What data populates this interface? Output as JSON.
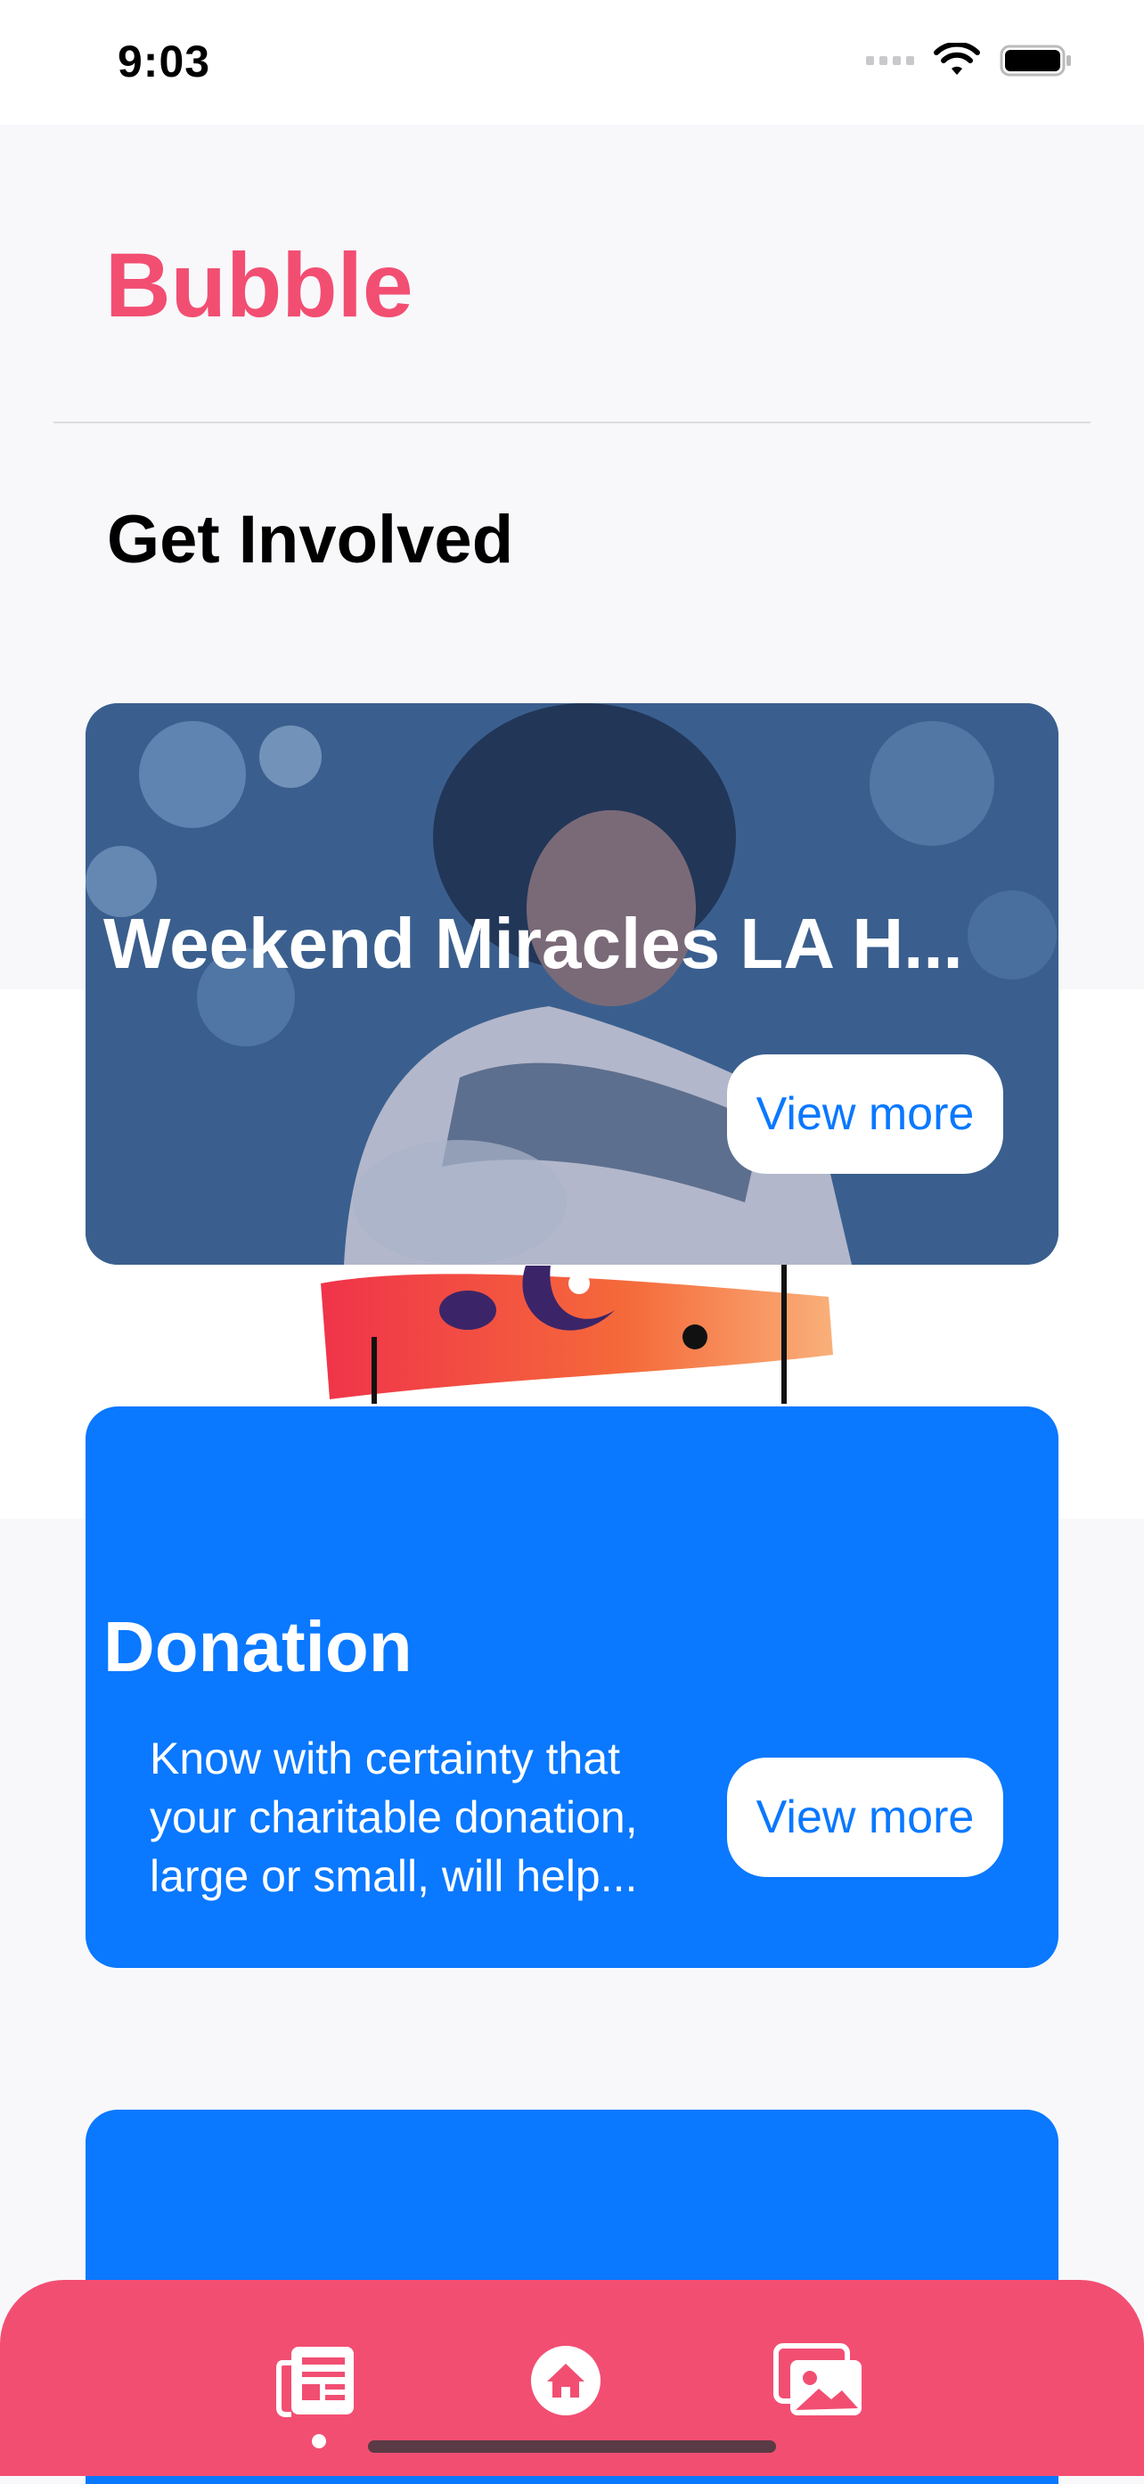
{
  "status_bar": {
    "time": "9:03"
  },
  "header": {
    "app_title": "Bubble",
    "brand_color": "#f24e72"
  },
  "section": {
    "title": "Get Involved"
  },
  "cards": [
    {
      "title": "Weekend Miracles LA H...",
      "button": "View more",
      "background": "photo-overlay"
    },
    {
      "title": "Donation",
      "description": "Know with certainty that your charitable donation, large or small, will help...",
      "button": "View more",
      "background": "#0a78ff"
    },
    {
      "title": "",
      "background": "#0a78ff"
    }
  ],
  "tab_bar": {
    "items": [
      {
        "icon": "newspaper-icon",
        "active": true
      },
      {
        "icon": "home-icon",
        "active": false
      },
      {
        "icon": "photos-icon",
        "active": false
      }
    ]
  }
}
